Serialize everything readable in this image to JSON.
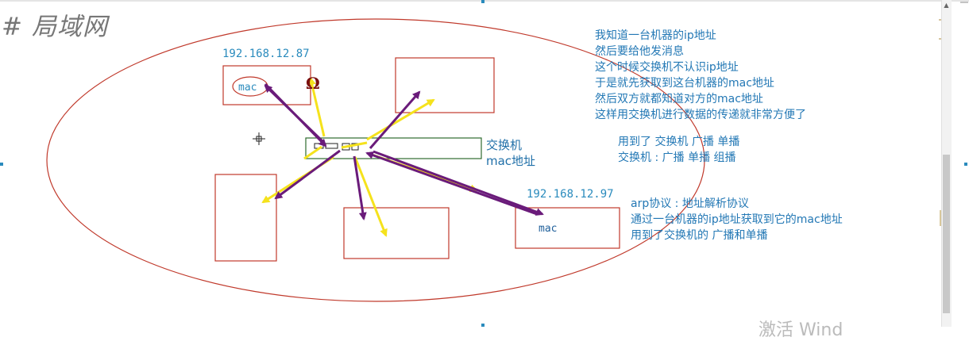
{
  "title": "# 局域网",
  "switch": {
    "label": "交换机",
    "sublabel": "mac地址"
  },
  "hosts": [
    {
      "ip": "192.168.12.87",
      "mac_label": "mac"
    },
    {
      "ip": "192.168.12.97",
      "mac_label": "mac"
    }
  ],
  "scribble": "Ω",
  "notes_top": [
    "我知道一台机器的ip地址",
    "然后要给他发消息",
    "这个时候交换机不认识ip地址",
    "于是就先获取到这台机器的mac地址",
    "然后双方就都知道对方的mac地址",
    "这样用交换机进行数据的传递就非常方便了"
  ],
  "notes_mid": [
    "用到了 交换机 广播  单播",
    "交换机 : 广播 单播 组播"
  ],
  "notes_bottom": [
    "arp协议 : 地址解析协议",
    "通过一台机器的ip地址获取到它的mac地址",
    "用到了交换机的 广播和单播"
  ],
  "watermark": "激活 Wind",
  "colors": {
    "ellipse": "#c0392b",
    "box": "#c0392b",
    "switch_box": "#2e6b2e",
    "arrow_purple": "#6a1b7a",
    "arrow_yellow": "#f5e21c",
    "text_blue": "#2378b5",
    "mac_red": "#7a1010"
  }
}
